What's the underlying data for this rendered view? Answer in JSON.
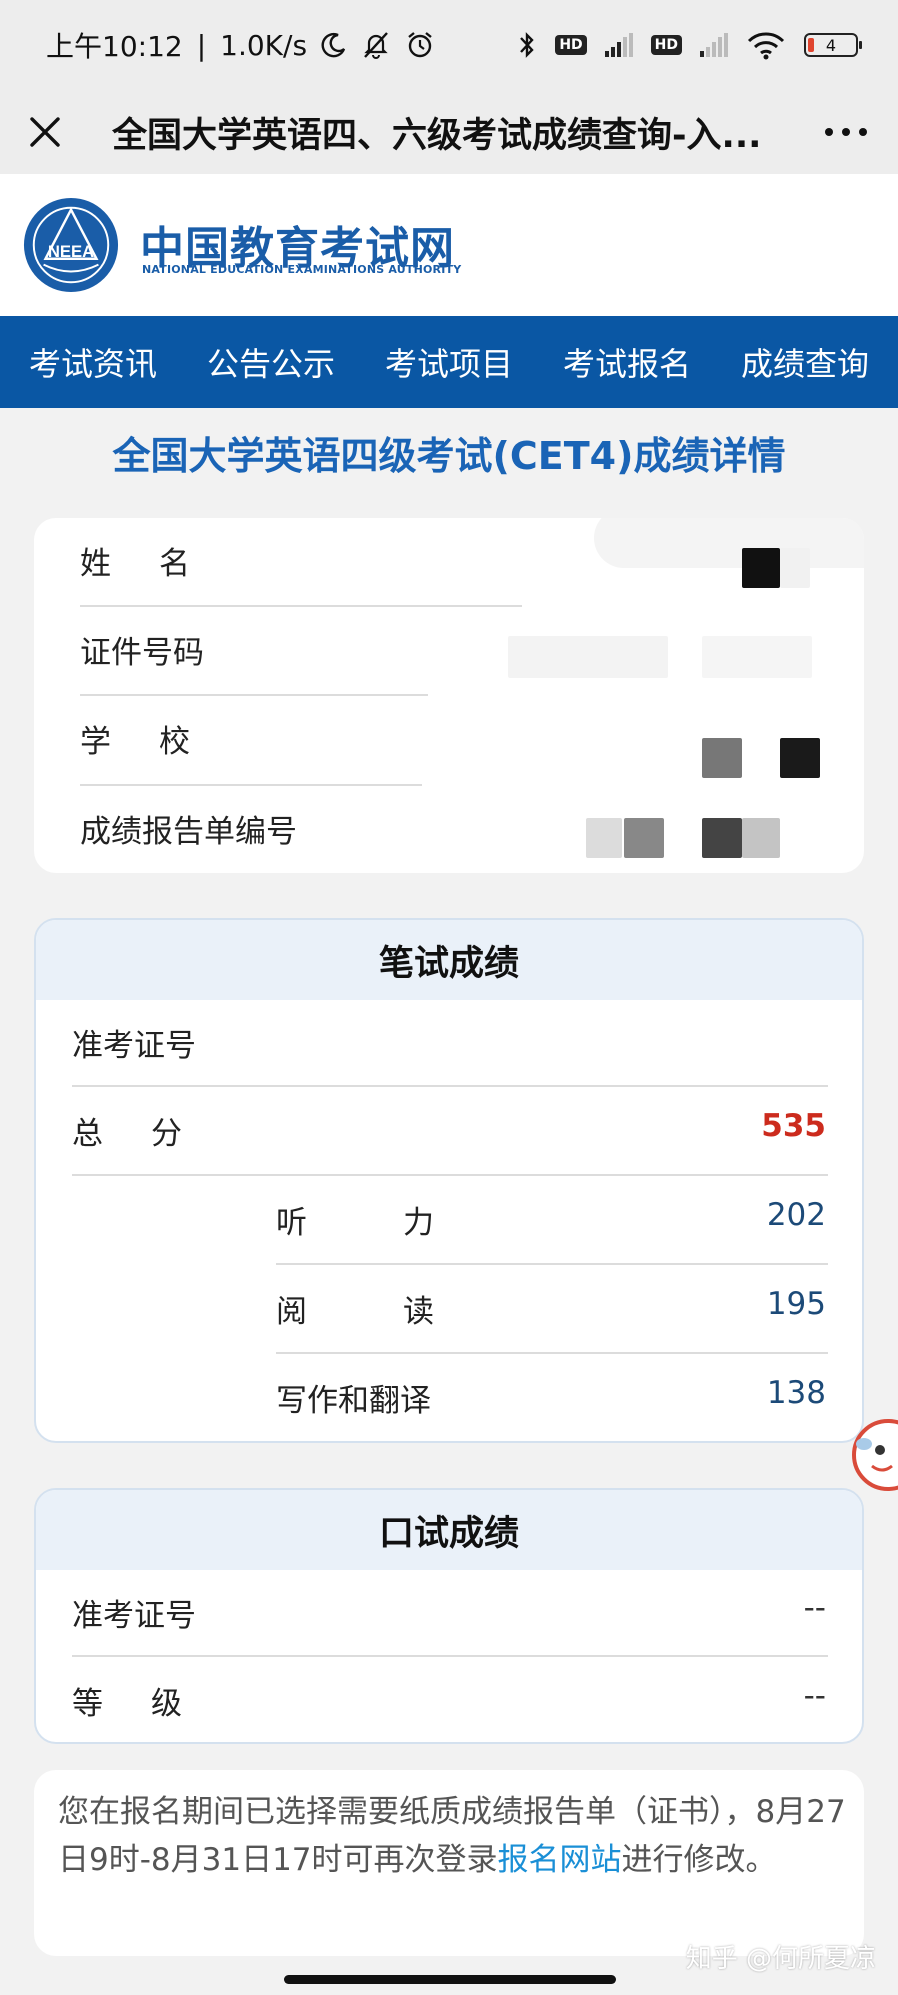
{
  "status_bar": {
    "time": "上午10:12",
    "speed": "1.0K/s",
    "net_type": "4G",
    "hd": "HD",
    "battery": "4"
  },
  "title_bar": {
    "title": "全国大学英语四、六级考试成绩查询-入..."
  },
  "logo": {
    "cn": "中国教育考试网",
    "en": "NATIONAL EDUCATION EXAMINATIONS AUTHORITY",
    "emblem": "NEEA"
  },
  "nav": {
    "items": [
      "考试资讯",
      "公告公示",
      "考试项目",
      "考试报名",
      "成绩查询"
    ]
  },
  "heading": "全国大学英语四级考试(CET4)成绩详情",
  "info": {
    "name_label": "姓名",
    "id_label": "证件号码",
    "school_label": "学校",
    "report_label": "成绩报告单编号"
  },
  "written": {
    "title": "笔试成绩",
    "ticket_label": "准考证号",
    "total_label": "总分",
    "total_value": "535",
    "listening_label": "听力",
    "listening_value": "202",
    "reading_label": "阅读",
    "reading_value": "195",
    "writing_label": "写作和翻译",
    "writing_value": "138"
  },
  "oral": {
    "title": "口试成绩",
    "ticket_label": "准考证号",
    "ticket_value": "--",
    "grade_label": "等级",
    "grade_value": "--"
  },
  "notice": {
    "text_before": "您在报名期间已选择需要纸质成绩报告单（证书），8月27日9时-8月31日17时可再次登录",
    "link": "报名网站",
    "text_after": "进行修改。"
  },
  "watermark": "知乎 @何所夏凉",
  "colors": {
    "nav_bg": "#0a57a4",
    "heading": "#1a64b6",
    "total_score": "#cc2b1d",
    "score_value": "#1c4a78",
    "link": "#1a8fd6"
  }
}
